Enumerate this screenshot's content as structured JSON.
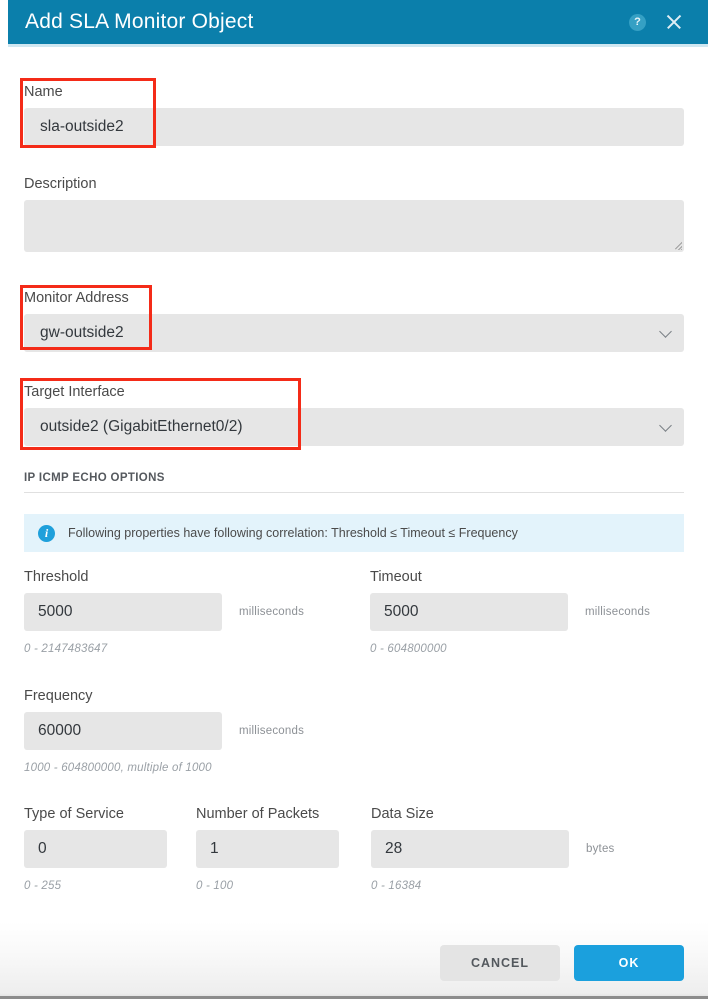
{
  "titlebar": {
    "title": "Add SLA Monitor Object",
    "help_icon": "help-circle-icon",
    "help_glyph": "?",
    "close_icon": "close-icon",
    "accent_color": "#0b7fab"
  },
  "form": {
    "name": {
      "label": "Name",
      "value": "sla-outside2",
      "placeholder": ""
    },
    "description": {
      "label": "Description",
      "value": "",
      "placeholder": ""
    },
    "monitor_address": {
      "label": "Monitor Address",
      "value": "gw-outside2"
    },
    "target_interface": {
      "label": "Target Interface",
      "value": "outside2 (GigabitEthernet0/2)"
    }
  },
  "section": {
    "title": "IP ICMP ECHO OPTIONS",
    "info_banner": {
      "icon": "info-icon",
      "glyph": "i",
      "text": "Following properties have following correlation: Threshold ≤ Timeout ≤ Frequency",
      "background_color": "#e3f3fb"
    }
  },
  "fields": {
    "threshold": {
      "label": "Threshold",
      "value": "5000",
      "unit": "milliseconds",
      "hint": "0 - 2147483647"
    },
    "timeout": {
      "label": "Timeout",
      "value": "5000",
      "unit": "milliseconds",
      "hint": "0 - 604800000"
    },
    "frequency": {
      "label": "Frequency",
      "value": "60000",
      "unit": "milliseconds",
      "hint": "1000 - 604800000, multiple of 1000"
    },
    "type_of_service": {
      "label": "Type of Service",
      "value": "0",
      "unit": "",
      "hint": "0 - 255"
    },
    "number_of_packets": {
      "label": "Number of Packets",
      "value": "1",
      "unit": "",
      "hint": "0 - 100"
    },
    "data_size": {
      "label": "Data Size",
      "value": "28",
      "unit": "bytes",
      "hint": "0 - 16384"
    }
  },
  "footer": {
    "cancel_label": "CANCEL",
    "ok_label": "OK",
    "ok_color": "#1ba0dd"
  }
}
